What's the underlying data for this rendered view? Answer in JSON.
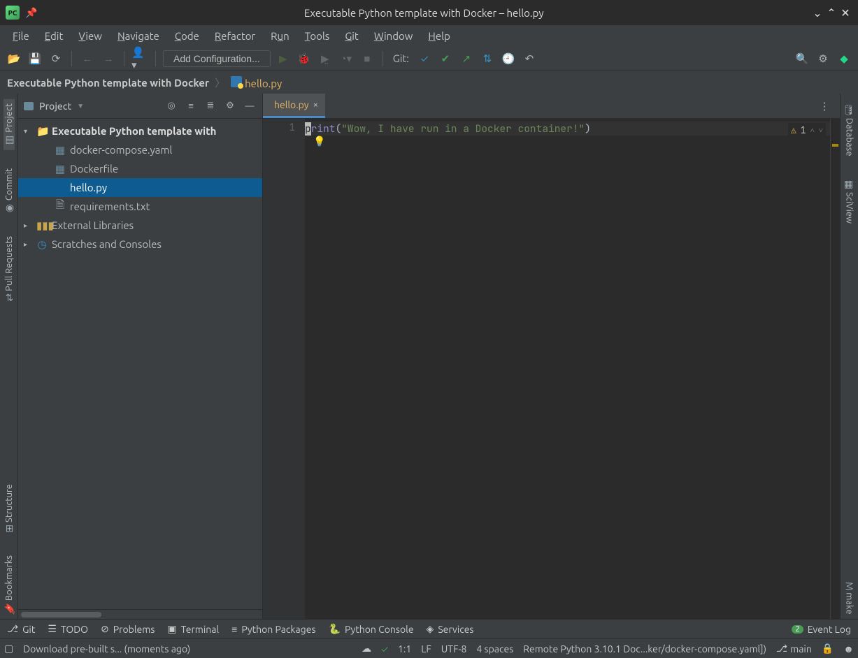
{
  "window": {
    "title": "Executable Python template with Docker – hello.py"
  },
  "menubar": [
    "File",
    "Edit",
    "View",
    "Navigate",
    "Code",
    "Refactor",
    "Run",
    "Tools",
    "Git",
    "Window",
    "Help"
  ],
  "toolbar": {
    "add_config_label": "Add Configuration...",
    "git_label": "Git:"
  },
  "breadcrumb": {
    "root": "Executable Python template with Docker",
    "file": "hello.py"
  },
  "projectpanel": {
    "title": "Project"
  },
  "tree": {
    "root": "Executable Python template with",
    "files": [
      "docker-compose.yaml",
      "Dockerfile",
      "hello.py",
      "requirements.txt"
    ],
    "external": "External Libraries",
    "scratches": "Scratches and Consoles",
    "selected_index": 2
  },
  "tab": {
    "name": "hello.py"
  },
  "editor": {
    "line_no": "1",
    "code_parts": {
      "cursor_char": "p",
      "fn": "rint",
      "lparen": "(",
      "string": "\"Wow, I have run in a Docker container!\"",
      "rparen": ")"
    },
    "warnings": "1"
  },
  "left_dock": [
    "Project",
    "Commit",
    "Pull Requests",
    "Structure",
    "Bookmarks"
  ],
  "right_dock": [
    "Database",
    "SciView",
    "make"
  ],
  "bottombar": [
    "Git",
    "TODO",
    "Problems",
    "Terminal",
    "Python Packages",
    "Python Console",
    "Services"
  ],
  "bottombar_right": {
    "event_log": "Event Log",
    "badge": "2"
  },
  "statusbar": {
    "msg": "Download pre-built s... (moments ago)",
    "pos": "1:1",
    "eol": "LF",
    "enc": "UTF-8",
    "indent": "4 spaces",
    "interp": "Remote Python 3.10.1 Doc...ker/docker-compose.yaml])",
    "branch": "main"
  }
}
